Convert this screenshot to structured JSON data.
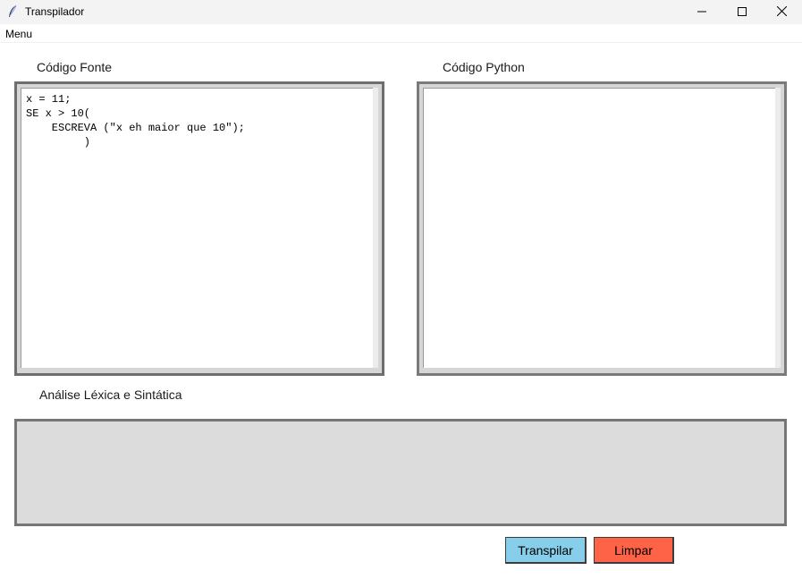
{
  "window": {
    "title": "Transpilador",
    "icon": "feather-icon"
  },
  "menubar": {
    "items": [
      {
        "label": "Menu"
      }
    ]
  },
  "source": {
    "label": "Código Fonte",
    "code": "x = 11;\nSE x > 10(\n    ESCREVA (\"x eh maior que 10\");\n         )"
  },
  "python": {
    "label": "Código Python",
    "code": ""
  },
  "analysis": {
    "label": "Análise Léxica e Sintática",
    "text": ""
  },
  "buttons": {
    "transpile_label": "Transpilar",
    "clear_label": "Limpar"
  },
  "colors": {
    "transpile_bg": "#87ceeb",
    "clear_bg": "#ff6347",
    "analysis_bg": "#dcdcdc"
  }
}
